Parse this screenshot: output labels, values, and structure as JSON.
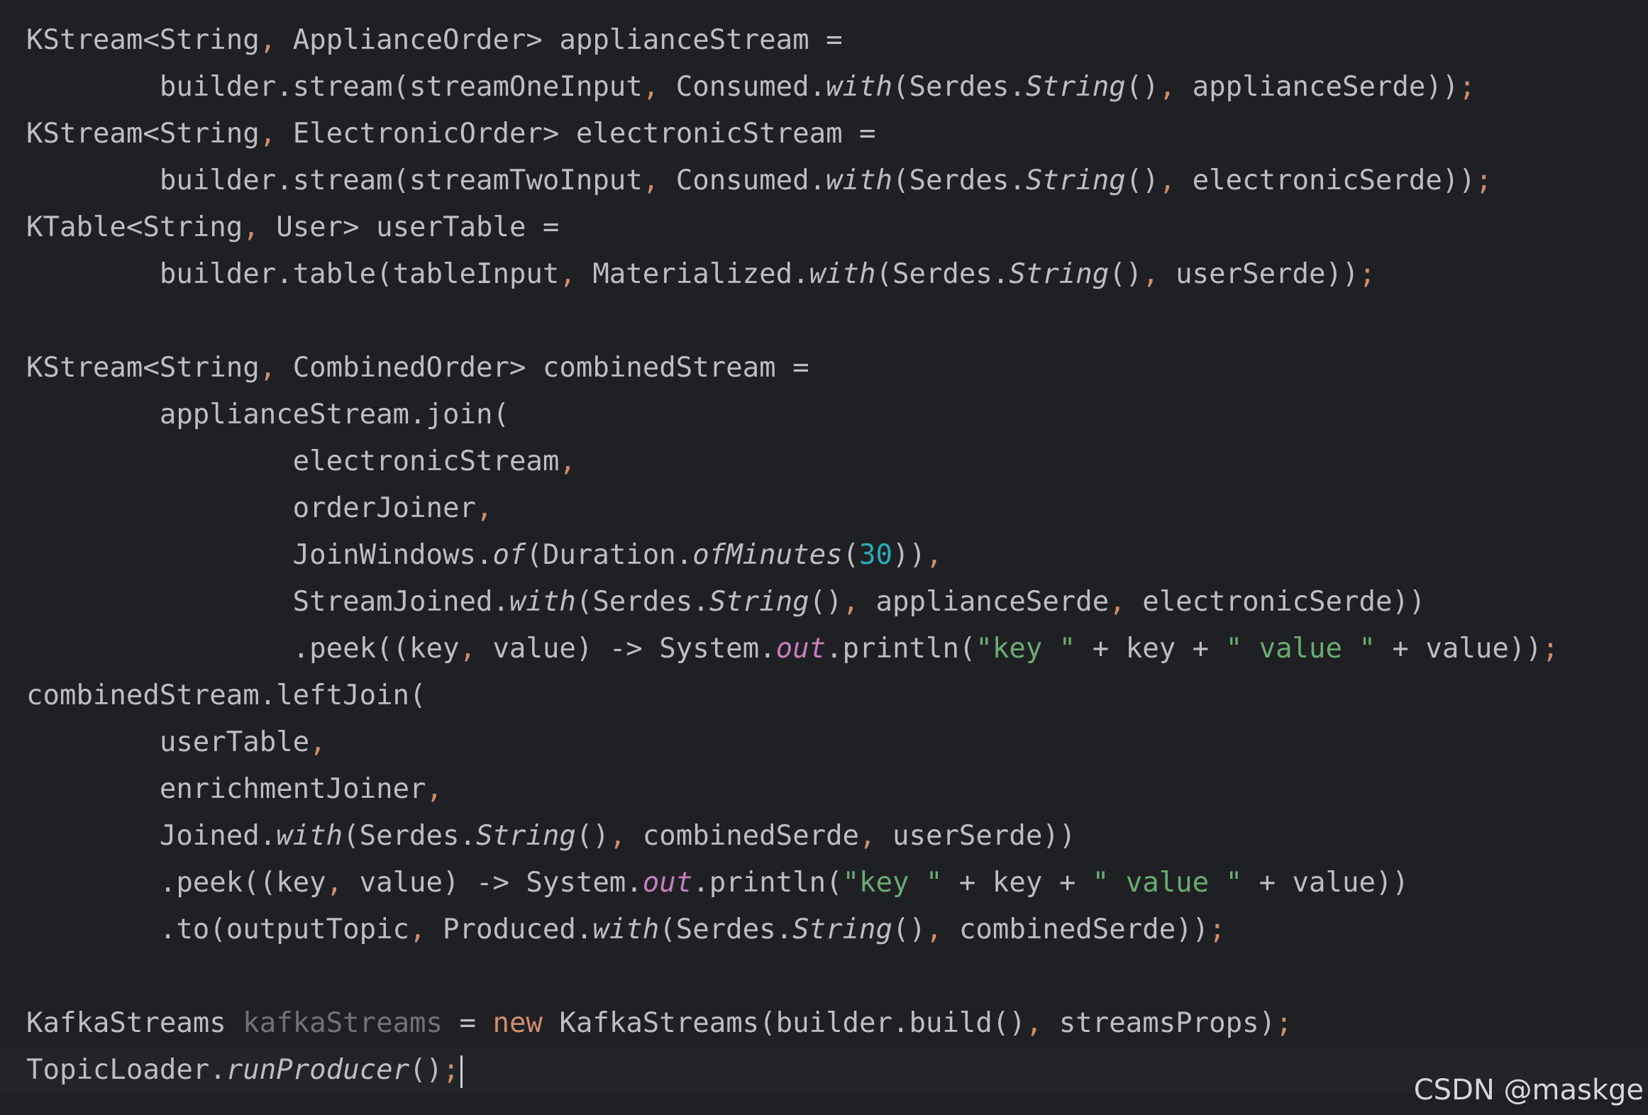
{
  "editor": {
    "lines": [
      [
        {
          "t": "KStream<String",
          "c": "plain"
        },
        {
          "t": ", ",
          "c": "punct"
        },
        {
          "t": "ApplianceOrder> applianceStream =",
          "c": "plain"
        }
      ],
      [
        {
          "t": "        builder.stream(streamOneInput",
          "c": "plain"
        },
        {
          "t": ", ",
          "c": "punct"
        },
        {
          "t": "Consumed.",
          "c": "plain"
        },
        {
          "t": "with",
          "c": "static"
        },
        {
          "t": "(Serdes.",
          "c": "plain"
        },
        {
          "t": "String",
          "c": "static"
        },
        {
          "t": "()",
          "c": "plain"
        },
        {
          "t": ", ",
          "c": "punct"
        },
        {
          "t": "applianceSerde))",
          "c": "plain"
        },
        {
          "t": ";",
          "c": "punct"
        }
      ],
      [
        {
          "t": "KStream<String",
          "c": "plain"
        },
        {
          "t": ", ",
          "c": "punct"
        },
        {
          "t": "ElectronicOrder> electronicStream =",
          "c": "plain"
        }
      ],
      [
        {
          "t": "        builder.stream(streamTwoInput",
          "c": "plain"
        },
        {
          "t": ", ",
          "c": "punct"
        },
        {
          "t": "Consumed.",
          "c": "plain"
        },
        {
          "t": "with",
          "c": "static"
        },
        {
          "t": "(Serdes.",
          "c": "plain"
        },
        {
          "t": "String",
          "c": "static"
        },
        {
          "t": "()",
          "c": "plain"
        },
        {
          "t": ", ",
          "c": "punct"
        },
        {
          "t": "electronicSerde))",
          "c": "plain"
        },
        {
          "t": ";",
          "c": "punct"
        }
      ],
      [
        {
          "t": "KTable<String",
          "c": "plain"
        },
        {
          "t": ", ",
          "c": "punct"
        },
        {
          "t": "User> userTable =",
          "c": "plain"
        }
      ],
      [
        {
          "t": "        builder.table(tableInput",
          "c": "plain"
        },
        {
          "t": ", ",
          "c": "punct"
        },
        {
          "t": "Materialized.",
          "c": "plain"
        },
        {
          "t": "with",
          "c": "static"
        },
        {
          "t": "(Serdes.",
          "c": "plain"
        },
        {
          "t": "String",
          "c": "static"
        },
        {
          "t": "()",
          "c": "plain"
        },
        {
          "t": ", ",
          "c": "punct"
        },
        {
          "t": "userSerde))",
          "c": "plain"
        },
        {
          "t": ";",
          "c": "punct"
        }
      ],
      [],
      [
        {
          "t": "KStream<String",
          "c": "plain"
        },
        {
          "t": ", ",
          "c": "punct"
        },
        {
          "t": "CombinedOrder> combinedStream =",
          "c": "plain"
        }
      ],
      [
        {
          "t": "        applianceStream.join(",
          "c": "plain"
        }
      ],
      [
        {
          "t": "                electronicStream",
          "c": "plain"
        },
        {
          "t": ",",
          "c": "punct"
        }
      ],
      [
        {
          "t": "                orderJoiner",
          "c": "plain"
        },
        {
          "t": ",",
          "c": "punct"
        }
      ],
      [
        {
          "t": "                JoinWindows.",
          "c": "plain"
        },
        {
          "t": "of",
          "c": "static"
        },
        {
          "t": "(Duration.",
          "c": "plain"
        },
        {
          "t": "ofMinutes",
          "c": "static"
        },
        {
          "t": "(",
          "c": "plain"
        },
        {
          "t": "30",
          "c": "num"
        },
        {
          "t": "))",
          "c": "plain"
        },
        {
          "t": ",",
          "c": "punct"
        }
      ],
      [
        {
          "t": "                StreamJoined.",
          "c": "plain"
        },
        {
          "t": "with",
          "c": "static"
        },
        {
          "t": "(Serdes.",
          "c": "plain"
        },
        {
          "t": "String",
          "c": "static"
        },
        {
          "t": "()",
          "c": "plain"
        },
        {
          "t": ", ",
          "c": "punct"
        },
        {
          "t": "applianceSerde",
          "c": "plain"
        },
        {
          "t": ", ",
          "c": "punct"
        },
        {
          "t": "electronicSerde))",
          "c": "plain"
        }
      ],
      [
        {
          "t": "                .peek((key",
          "c": "plain"
        },
        {
          "t": ", ",
          "c": "punct"
        },
        {
          "t": "value) -> System.",
          "c": "plain"
        },
        {
          "t": "out",
          "c": "field"
        },
        {
          "t": ".println(",
          "c": "plain"
        },
        {
          "t": "\"key \"",
          "c": "str"
        },
        {
          "t": " + key + ",
          "c": "plain"
        },
        {
          "t": "\" value \"",
          "c": "str"
        },
        {
          "t": " + value))",
          "c": "plain"
        },
        {
          "t": ";",
          "c": "punct"
        }
      ],
      [
        {
          "t": "combinedStream.leftJoin(",
          "c": "plain"
        }
      ],
      [
        {
          "t": "        userTable",
          "c": "plain"
        },
        {
          "t": ",",
          "c": "punct"
        }
      ],
      [
        {
          "t": "        enrichmentJoiner",
          "c": "plain"
        },
        {
          "t": ",",
          "c": "punct"
        }
      ],
      [
        {
          "t": "        Joined.",
          "c": "plain"
        },
        {
          "t": "with",
          "c": "static"
        },
        {
          "t": "(Serdes.",
          "c": "plain"
        },
        {
          "t": "String",
          "c": "static"
        },
        {
          "t": "()",
          "c": "plain"
        },
        {
          "t": ", ",
          "c": "punct"
        },
        {
          "t": "combinedSerde",
          "c": "plain"
        },
        {
          "t": ", ",
          "c": "punct"
        },
        {
          "t": "userSerde))",
          "c": "plain"
        }
      ],
      [
        {
          "t": "        .peek((key",
          "c": "plain"
        },
        {
          "t": ", ",
          "c": "punct"
        },
        {
          "t": "value) -> System.",
          "c": "plain"
        },
        {
          "t": "out",
          "c": "field"
        },
        {
          "t": ".println(",
          "c": "plain"
        },
        {
          "t": "\"key \"",
          "c": "str"
        },
        {
          "t": " + key + ",
          "c": "plain"
        },
        {
          "t": "\" value \"",
          "c": "str"
        },
        {
          "t": " + value))",
          "c": "plain"
        }
      ],
      [
        {
          "t": "        .to(outputTopic",
          "c": "plain"
        },
        {
          "t": ", ",
          "c": "punct"
        },
        {
          "t": "Produced.",
          "c": "plain"
        },
        {
          "t": "with",
          "c": "static"
        },
        {
          "t": "(Serdes.",
          "c": "plain"
        },
        {
          "t": "String",
          "c": "static"
        },
        {
          "t": "()",
          "c": "plain"
        },
        {
          "t": ", ",
          "c": "punct"
        },
        {
          "t": "combinedSerde))",
          "c": "plain"
        },
        {
          "t": ";",
          "c": "punct"
        }
      ],
      [],
      [
        {
          "t": "KafkaStreams ",
          "c": "plain"
        },
        {
          "t": "kafkaStreams",
          "c": "unused"
        },
        {
          "t": " = ",
          "c": "plain"
        },
        {
          "t": "new",
          "c": "kw"
        },
        {
          "t": " KafkaStreams(builder.build()",
          "c": "plain"
        },
        {
          "t": ", ",
          "c": "punct"
        },
        {
          "t": "streamsProps)",
          "c": "plain"
        },
        {
          "t": ";",
          "c": "punct"
        }
      ],
      [
        {
          "t": "TopicLoader.",
          "c": "plain"
        },
        {
          "t": "runProducer",
          "c": "static"
        },
        {
          "t": "()",
          "c": "plain"
        },
        {
          "t": ";",
          "c": "punct"
        }
      ]
    ]
  },
  "watermark": {
    "text": "CSDN @maskge"
  }
}
